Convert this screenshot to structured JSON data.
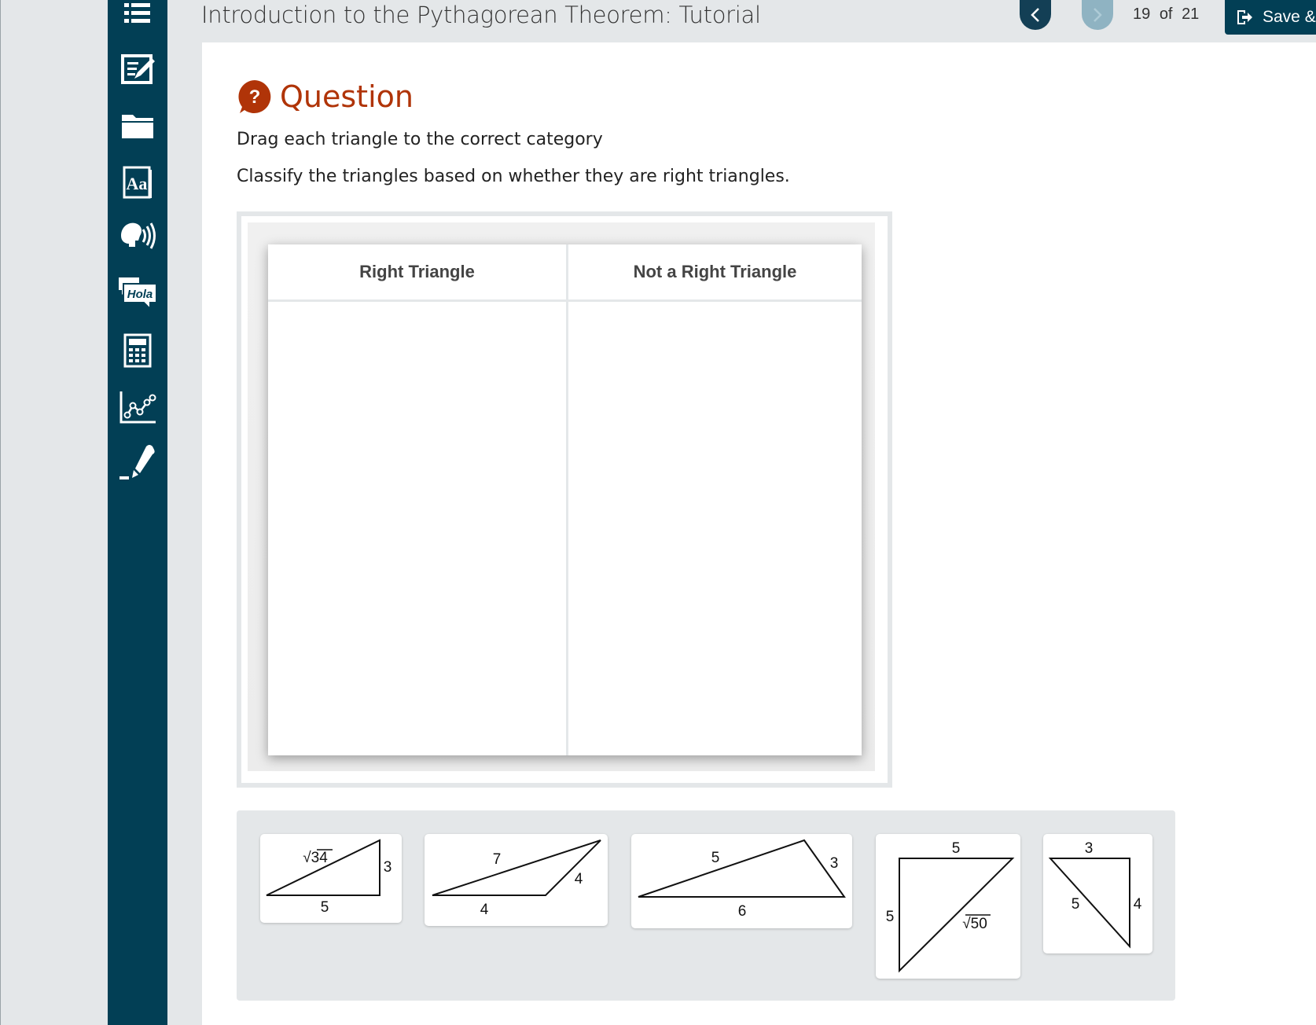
{
  "header": {
    "title": "Introduction to the Pythagorean Theorem: Tutorial",
    "page_current": "19",
    "page_of": "of",
    "page_total": "21",
    "save_label": "Save &"
  },
  "sidebar": {
    "tools": [
      "menu-icon",
      "notes-icon",
      "folder-icon",
      "glossary-icon",
      "text-to-speech-icon",
      "translate-icon",
      "calculator-icon",
      "graph-icon",
      "highlighter-icon"
    ],
    "translate_label": "Hola",
    "glossary_label": "Aa"
  },
  "question": {
    "heading": "Question",
    "icon_glyph": "?",
    "instruction_1": "Drag each triangle to the correct category",
    "instruction_2": "Classify the triangles based on whether they are right triangles."
  },
  "categories": [
    {
      "label": "Right Triangle"
    },
    {
      "label": "Not a Right Triangle"
    }
  ],
  "tiles": [
    {
      "labels": {
        "hyp": "√34",
        "leg_v": "3",
        "leg_h": "5"
      }
    },
    {
      "labels": {
        "top": "7",
        "right": "4",
        "bottom": "4"
      }
    },
    {
      "labels": {
        "left": "5",
        "right": "3",
        "bottom": "6"
      }
    },
    {
      "labels": {
        "top": "5",
        "left": "5",
        "hyp": "√50"
      }
    },
    {
      "labels": {
        "top": "3",
        "hyp": "5",
        "right": "4"
      }
    }
  ],
  "colors": {
    "sidebar": "#023f55",
    "question_accent": "#b03408",
    "background": "#e4e7e9"
  }
}
